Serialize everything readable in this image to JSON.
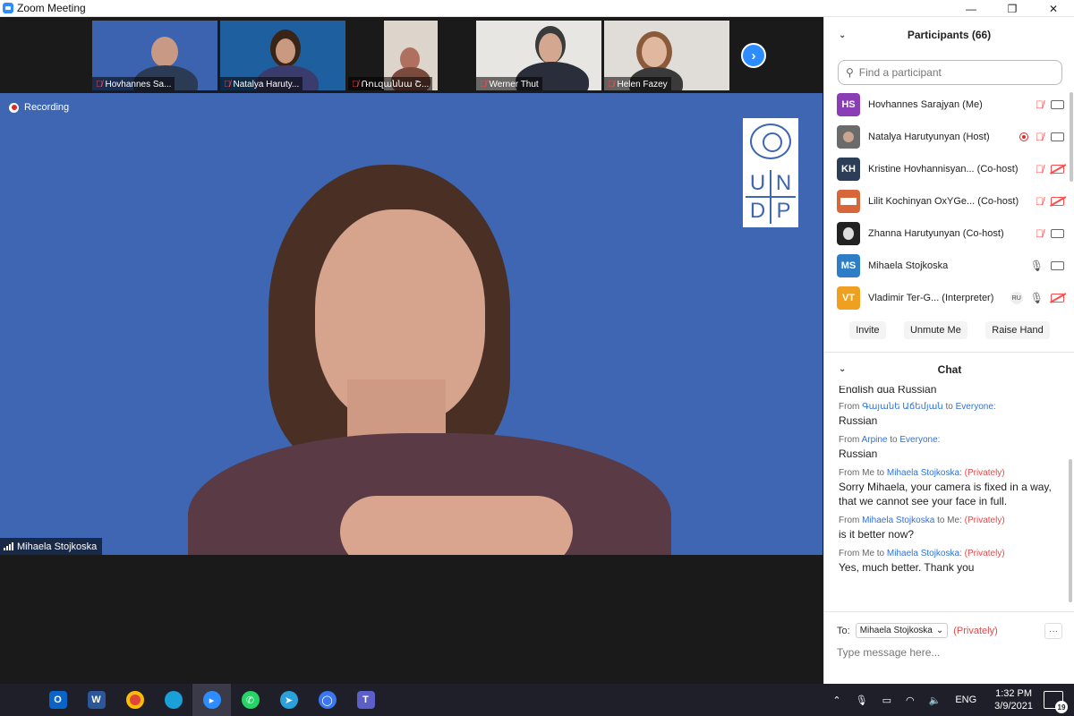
{
  "window": {
    "title": "Zoom Meeting",
    "minimize": "—",
    "maximize": "❐",
    "close": "✕"
  },
  "thumbnails": [
    {
      "name": "Hovhannes Sa..."
    },
    {
      "name": "Natalya Haruty..."
    },
    {
      "name": "Ռուզաննա Շ..."
    },
    {
      "name": "Werner Thut"
    },
    {
      "name": "Helen Fazey"
    }
  ],
  "recording_label": "Recording",
  "speaker": {
    "name": "Mihaela Stojkoska"
  },
  "logo": {
    "letters": [
      "U",
      "N",
      "D",
      "P"
    ]
  },
  "participants": {
    "title": "Participants (66)",
    "search_placeholder": "Find a participant",
    "list": [
      {
        "initials": "HS",
        "name": "Hovhannes Sarajyan (Me)",
        "color": "#8a3db5"
      },
      {
        "initials": "",
        "name": "Natalya Harutyunyan (Host)",
        "color": "#6b6b6b"
      },
      {
        "initials": "KH",
        "name": "Kristine Hovhannisyan... (Co-host)",
        "color": "#2c3e57"
      },
      {
        "initials": "",
        "name": "Lilit Kochinyan OxYGe... (Co-host)",
        "color": "#d9653b"
      },
      {
        "initials": "",
        "name": "Zhanna Harutyunyan (Co-host)",
        "color": "#222222"
      },
      {
        "initials": "MS",
        "name": "Mihaela Stojkoska",
        "color": "#2e7ec7"
      },
      {
        "initials": "VT",
        "name": "Vladimir Ter-G... (Interpreter)",
        "color": "#f0a020",
        "badge": "RU"
      }
    ],
    "buttons": {
      "invite": "Invite",
      "unmute": "Unmute Me",
      "raise_hand": "Raise Hand"
    }
  },
  "chat": {
    "title": "Chat",
    "cut_text": "English qua Russian",
    "messages": [
      {
        "from_label": "From",
        "sender": "Գայանե Աճեմյան",
        "to_label": "to",
        "recipient": "Everyone:",
        "private": "",
        "text": "Russian"
      },
      {
        "from_label": "From",
        "sender": "Arpine",
        "to_label": "to",
        "recipient": "Everyone:",
        "private": "",
        "text": "Russian"
      },
      {
        "from_label": "From Me",
        "sender": "",
        "to_label": "to",
        "recipient": "Mihaela Stojkoska:",
        "private": "(Privately)",
        "text": "Sorry Mihaela, your camera is fixed in a way, that we cannot see your face in full."
      },
      {
        "from_label": "From",
        "sender": "Mihaela Stojkoska",
        "to_label": "to Me:",
        "recipient": "",
        "private": "(Privately)",
        "text": "is it better now?"
      },
      {
        "from_label": "From Me",
        "sender": "",
        "to_label": "to",
        "recipient": "Mihaela Stojkoska:",
        "private": "(Privately)",
        "text": "Yes, much better. Thank you"
      }
    ],
    "to_label": "To:",
    "to_value": "Mihaela Stojkoska",
    "to_private": "(Privately)",
    "more": "···",
    "input_placeholder": "Type message here..."
  },
  "taskbar": {
    "language": "ENG",
    "time": "1:32 PM",
    "date": "3/9/2021",
    "notifications": "19"
  },
  "colors": {
    "zoom_blue": "#2d8cff",
    "undp_blue": "#3e66b3",
    "muted_red": "#ff4b4b"
  }
}
